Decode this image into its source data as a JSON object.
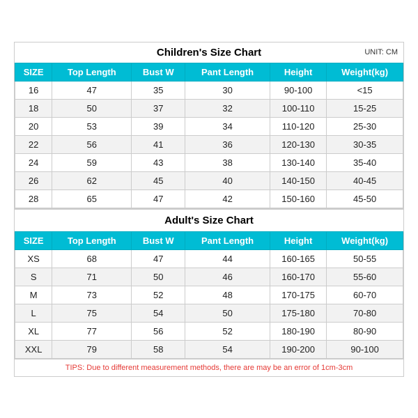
{
  "children_title": "Children's Size Chart",
  "adult_title": "Adult's Size Chart",
  "unit_label": "UNIT: CM",
  "headers": [
    "SIZE",
    "Top Length",
    "Bust W",
    "Pant Length",
    "Height",
    "Weight(kg)"
  ],
  "children_rows": [
    [
      "16",
      "47",
      "35",
      "30",
      "90-100",
      "<15"
    ],
    [
      "18",
      "50",
      "37",
      "32",
      "100-110",
      "15-25"
    ],
    [
      "20",
      "53",
      "39",
      "34",
      "110-120",
      "25-30"
    ],
    [
      "22",
      "56",
      "41",
      "36",
      "120-130",
      "30-35"
    ],
    [
      "24",
      "59",
      "43",
      "38",
      "130-140",
      "35-40"
    ],
    [
      "26",
      "62",
      "45",
      "40",
      "140-150",
      "40-45"
    ],
    [
      "28",
      "65",
      "47",
      "42",
      "150-160",
      "45-50"
    ]
  ],
  "adult_rows": [
    [
      "XS",
      "68",
      "47",
      "44",
      "160-165",
      "50-55"
    ],
    [
      "S",
      "71",
      "50",
      "46",
      "160-170",
      "55-60"
    ],
    [
      "M",
      "73",
      "52",
      "48",
      "170-175",
      "60-70"
    ],
    [
      "L",
      "75",
      "54",
      "50",
      "175-180",
      "70-80"
    ],
    [
      "XL",
      "77",
      "56",
      "52",
      "180-190",
      "80-90"
    ],
    [
      "XXL",
      "79",
      "58",
      "54",
      "190-200",
      "90-100"
    ]
  ],
  "tips": "TIPS: Due to different measurement methods, there are may be an error of 1cm-3cm"
}
